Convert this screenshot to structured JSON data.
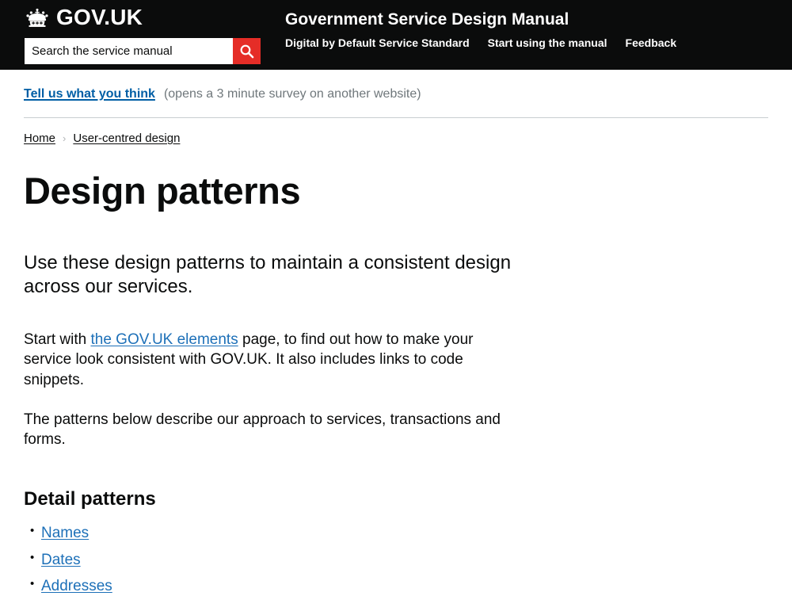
{
  "header": {
    "brand_name": "GOV.UK",
    "crown_icon": "crown-icon",
    "search": {
      "placeholder": "Search the service manual",
      "value": "",
      "button_icon": "search-icon",
      "button_color": "#e52d27"
    },
    "title": "Government Service Design Manual",
    "nav": [
      {
        "label": "Digital by Default Service Standard"
      },
      {
        "label": "Start using the manual"
      },
      {
        "label": "Feedback"
      }
    ],
    "background_color": "#0b0c0c"
  },
  "phase_banner": {
    "link_label": "Tell us what you think",
    "note": "(opens a 3 minute survey on another website)",
    "link_color": "#005ea5",
    "note_color": "#6f777b"
  },
  "breadcrumb": {
    "items": [
      {
        "label": "Home"
      },
      {
        "label": "User-centred design"
      }
    ],
    "separator": "›"
  },
  "main": {
    "title": "Design patterns",
    "lead": "Use these design patterns to maintain a consistent design across our services.",
    "paragraphs": [
      {
        "before": "Start with ",
        "link": "the GOV.UK elements",
        "after": " page, to find out how to make your service look consistent with GOV.UK. It also includes links to code snippets."
      },
      {
        "text": "The patterns below describe our approach to services, transactions and forms."
      }
    ],
    "section": {
      "heading": "Detail patterns",
      "links": [
        {
          "label": "Names"
        },
        {
          "label": "Dates"
        },
        {
          "label": "Addresses"
        }
      ]
    },
    "link_color": "#1d70b8"
  }
}
